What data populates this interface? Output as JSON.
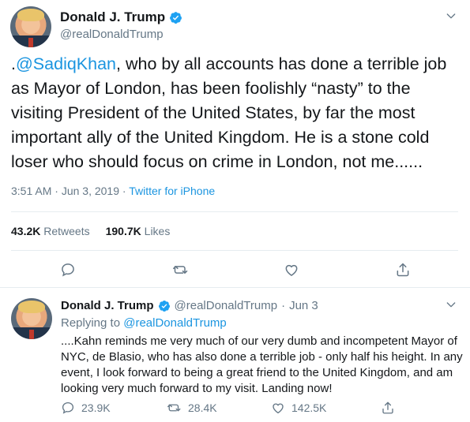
{
  "main_tweet": {
    "display_name": "Donald J. Trump",
    "handle": "@realDonaldTrump",
    "text_prefix": ".",
    "mention": "@SadiqKhan",
    "text_body": ", who by all accounts has done a terrible job as Mayor of London, has been foolishly “nasty” to the visiting President of the United States, by far the most important ally of the United Kingdom. He is a stone cold loser who should focus on crime in London, not me......",
    "time": "3:51 AM",
    "date": "Jun 3, 2019",
    "source": "Twitter for iPhone",
    "dot": "·",
    "retweets_count": "43.2K",
    "retweets_label": "Retweets",
    "likes_count": "190.7K",
    "likes_label": "Likes"
  },
  "reply_tweet": {
    "display_name": "Donald J. Trump",
    "handle": "@realDonaldTrump",
    "dot": "·",
    "date": "Jun 3",
    "replying_label": "Replying to",
    "replying_to": "@realDonaldTrump",
    "text": "....Kahn reminds me very much of our very dumb and incompetent Mayor of NYC, de Blasio, who has also done a terrible job - only half his height. In any event, I look forward to being a great friend to the United Kingdom, and am looking very much forward to my visit. Landing now!",
    "replies": "23.9K",
    "retweets": "28.4K",
    "likes": "142.5K"
  },
  "icons": {
    "verified": "verified-badge-icon",
    "menu": "chevron-down-icon",
    "reply": "reply-icon",
    "retweet": "retweet-icon",
    "like": "heart-icon",
    "share": "share-icon"
  },
  "colors": {
    "accent": "#1b95e0",
    "text": "#14171a",
    "muted": "#657786",
    "divider": "#e6ecf0"
  }
}
